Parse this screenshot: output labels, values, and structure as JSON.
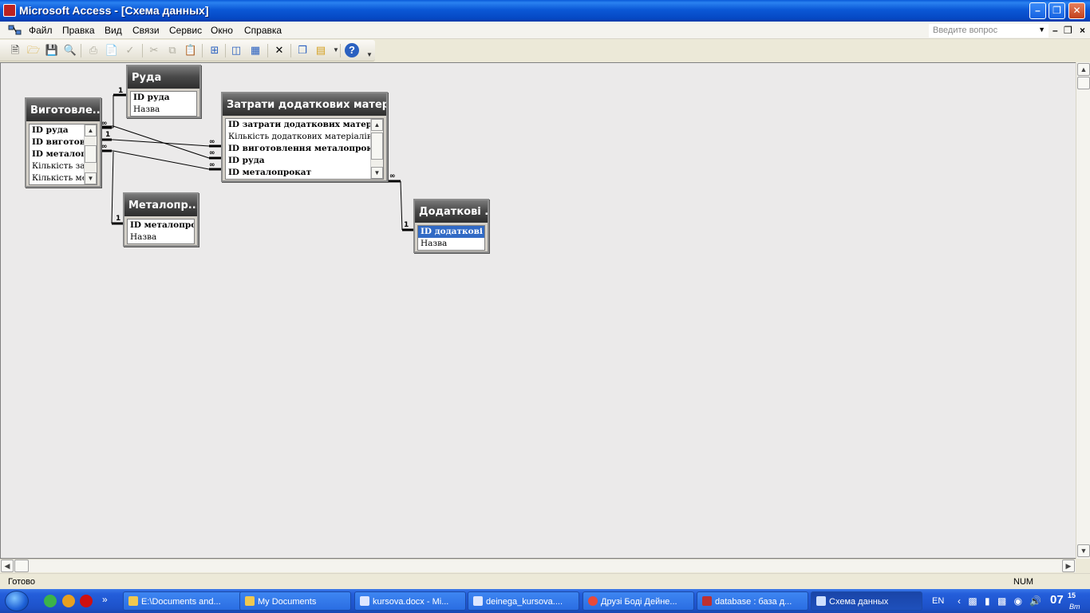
{
  "window": {
    "title": "Microsoft Access - [Схема данных]"
  },
  "menu": {
    "items": [
      "Файл",
      "Правка",
      "Вид",
      "Связи",
      "Сервис",
      "Окно",
      "Справка"
    ],
    "help_placeholder": "Введите вопрос"
  },
  "toolbar": {
    "buttons": [
      "new-icon",
      "open-icon",
      "save-icon",
      "search-icon",
      "print-icon",
      "print-preview-icon",
      "spelling-icon",
      "cut-icon",
      "copy-icon",
      "paste-icon",
      "show-table-icon",
      "show-direct-icon",
      "show-all-icon",
      "delete-icon",
      "window-icon",
      "new-object-icon",
      "help-icon"
    ]
  },
  "tables": {
    "ruda": {
      "title": "Руда",
      "fields": [
        "ID руда",
        "Назва"
      ]
    },
    "vyhotovlennia": {
      "title": "Виготовле...",
      "fields": [
        "ID руда",
        "ID виготовле",
        "ID металопро",
        "Кількість зат",
        "Кількість мет"
      ]
    },
    "zatraty": {
      "title": "Затрати додаткових матеріа...",
      "fields": [
        "ID затрати додаткових матеріалів",
        "Кількість додаткових матеріалів",
        "ID виготовлення металопрокату",
        "ID руда",
        "ID металопрокат"
      ]
    },
    "metaloprokat": {
      "title": "Металопр...",
      "fields": [
        "ID металопрокат",
        "Назва"
      ]
    },
    "dodatkovi": {
      "title": "Додаткові ...",
      "fields": [
        "ID додаткові ма",
        "Назва"
      ]
    }
  },
  "relations": {
    "one_label": "1",
    "many_label": "∞"
  },
  "status": {
    "text": "Готово",
    "num": "NUM"
  },
  "taskbar": {
    "tasks": [
      "E:\\Documents and...",
      "My Documents",
      "kursova.docx - Mi...",
      "deinega_kursova....",
      "Друзі Боді Дейне...",
      "database : база д...",
      "Схема данных"
    ],
    "lang": "EN",
    "clock": "07",
    "clock_min": "15",
    "day": "Вт"
  }
}
